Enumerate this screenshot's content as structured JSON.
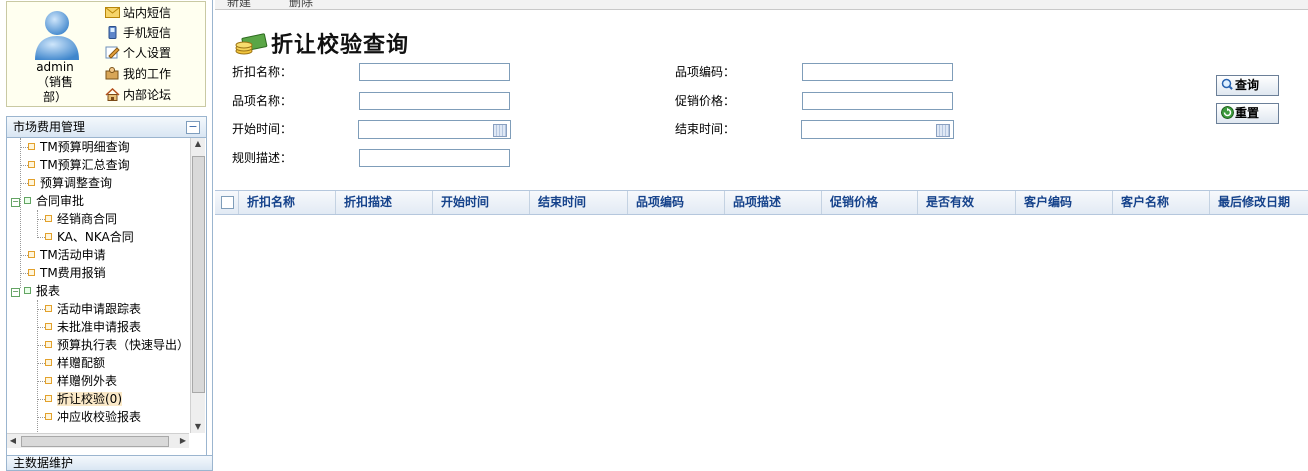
{
  "user": {
    "name_lines": [
      "admin",
      "（销售",
      "部）"
    ],
    "links": [
      {
        "label": "站内短信",
        "icon": "mail-icon"
      },
      {
        "label": "手机短信",
        "icon": "mobile-phone-icon"
      },
      {
        "label": "个人设置",
        "icon": "edit-settings-icon"
      },
      {
        "label": "我的工作",
        "icon": "briefcase-user-icon"
      },
      {
        "label": "内部论坛",
        "icon": "home-forum-icon"
      }
    ]
  },
  "menu": {
    "title": "市场费用管理",
    "collapse_symbol": "−",
    "items": [
      {
        "label": "TM预算明细查询",
        "level": 1,
        "type": "leaf"
      },
      {
        "label": "TM预算汇总查询",
        "level": 1,
        "type": "leaf"
      },
      {
        "label": "预算调整查询",
        "level": 1,
        "type": "leaf"
      },
      {
        "label": "合同审批",
        "level": 0,
        "type": "folder"
      },
      {
        "label": "经销商合同",
        "level": 2,
        "type": "leaf"
      },
      {
        "label": "KA、NKA合同",
        "level": 2,
        "type": "leaf"
      },
      {
        "label": "TM活动申请",
        "level": 1,
        "type": "leaf"
      },
      {
        "label": "TM费用报销",
        "level": 1,
        "type": "leaf"
      },
      {
        "label": "报表",
        "level": 0,
        "type": "folder"
      },
      {
        "label": "活动申请跟踪表",
        "level": 2,
        "type": "leaf"
      },
      {
        "label": "未批准申请报表",
        "level": 2,
        "type": "leaf"
      },
      {
        "label": "预算执行表（快速导出）",
        "level": 2,
        "type": "leaf"
      },
      {
        "label": "样赠配额",
        "level": 2,
        "type": "leaf"
      },
      {
        "label": "样赠例外表",
        "level": 2,
        "type": "leaf"
      },
      {
        "label": "折让校验(0)",
        "level": 2,
        "type": "leaf",
        "selected": true
      },
      {
        "label": "冲应收校验报表",
        "level": 2,
        "type": "leaf"
      }
    ],
    "next_panel_title": "主数据维护"
  },
  "toolbar": {
    "new_label": "新建",
    "delete_label": "删除"
  },
  "page": {
    "title": "折让校验查询",
    "fields": {
      "discount_name": {
        "label": "折扣名称：",
        "value": ""
      },
      "item_code": {
        "label": "品项编码：",
        "value": ""
      },
      "item_name": {
        "label": "品项名称：",
        "value": ""
      },
      "promo_price": {
        "label": "促销价格：",
        "value": ""
      },
      "start_time": {
        "label": "开始时间：",
        "value": ""
      },
      "end_time": {
        "label": "结束时间：",
        "value": ""
      },
      "rule_desc": {
        "label": "规则描述：",
        "value": ""
      }
    },
    "buttons": {
      "query": "查询",
      "reset": "重置"
    }
  },
  "grid": {
    "columns": [
      "折扣名称",
      "折扣描述",
      "开始时间",
      "结束时间",
      "品项编码",
      "品项描述",
      "促销价格",
      "是否有效",
      "客户编码",
      "客户名称",
      "最后修改日期"
    ],
    "rows": []
  },
  "colors": {
    "accent": "#15428b",
    "border": "#9bb5cf",
    "selected": "#fbe9c8"
  }
}
